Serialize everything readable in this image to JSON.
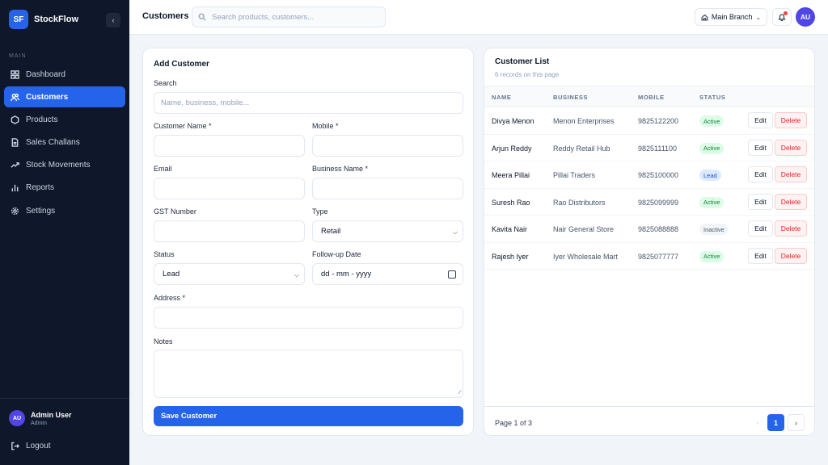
{
  "app": {
    "logo": "SF",
    "name": "StockFlow",
    "collapse_icon": "chevron-left-icon"
  },
  "sidebar": {
    "section_label": "MAIN",
    "items": [
      {
        "label": "Dashboard",
        "icon": "grid-icon",
        "active": false
      },
      {
        "label": "Customers",
        "icon": "users-icon",
        "active": true
      },
      {
        "label": "Products",
        "icon": "box-icon",
        "active": false
      },
      {
        "label": "Sales Challans",
        "icon": "document-icon",
        "active": false
      },
      {
        "label": "Stock Movements",
        "icon": "trend-icon",
        "active": false
      },
      {
        "label": "Reports",
        "icon": "bar-chart-icon",
        "active": false
      },
      {
        "label": "Settings",
        "icon": "gear-icon",
        "active": false
      }
    ],
    "user": {
      "initials": "AU",
      "name": "Admin User",
      "role": "Admin"
    },
    "logout_label": "Logout"
  },
  "header": {
    "title": "Customers",
    "search_placeholder": "Search products, customers...",
    "branch": "Main Branch",
    "avatar": "AU"
  },
  "form": {
    "title": "Add Customer",
    "search_label": "Search",
    "search_placeholder": "Name, business, mobile...",
    "customer_name_label": "Customer Name *",
    "mobile_label": "Mobile *",
    "email_label": "Email",
    "business_name_label": "Business Name *",
    "gst_label": "GST Number",
    "type_label": "Type",
    "type_value": "Retail",
    "status_label": "Status",
    "status_value": "Lead",
    "followup_label": "Follow-up Date",
    "followup_placeholder": "dd - mm - yyyy",
    "address_label": "Address *",
    "notes_label": "Notes",
    "save_label": "Save Customer"
  },
  "list": {
    "title": "Customer List",
    "subtitle": "6 records on this page",
    "columns": [
      "NAME",
      "BUSINESS",
      "MOBILE",
      "STATUS"
    ],
    "edit_label": "Edit",
    "delete_label": "Delete",
    "rows": [
      {
        "name": "Divya Menon",
        "business": "Menon Enterprises",
        "mobile": "9825122200",
        "status": "Active"
      },
      {
        "name": "Arjun Reddy",
        "business": "Reddy Retail Hub",
        "mobile": "9825111100",
        "status": "Active"
      },
      {
        "name": "Meera Pillai",
        "business": "Pillai Traders",
        "mobile": "9825100000",
        "status": "Lead"
      },
      {
        "name": "Suresh Rao",
        "business": "Rao Distributors",
        "mobile": "9825099999",
        "status": "Active"
      },
      {
        "name": "Kavita Nair",
        "business": "Nair General Store",
        "mobile": "9825088888",
        "status": "Inactive"
      },
      {
        "name": "Rajesh Iyer",
        "business": "Iyer Wholesale Mart",
        "mobile": "9825077777",
        "status": "Active"
      }
    ],
    "page_info": "Page 1 of 3",
    "current_page": "1",
    "prev_label": "‹",
    "next_label": "›"
  },
  "colors": {
    "primary": "#2563eb",
    "sidebar_bg": "#0f172a",
    "active_green": "#15803d",
    "lead_blue": "#1d4ed8",
    "danger": "#dc2626"
  }
}
